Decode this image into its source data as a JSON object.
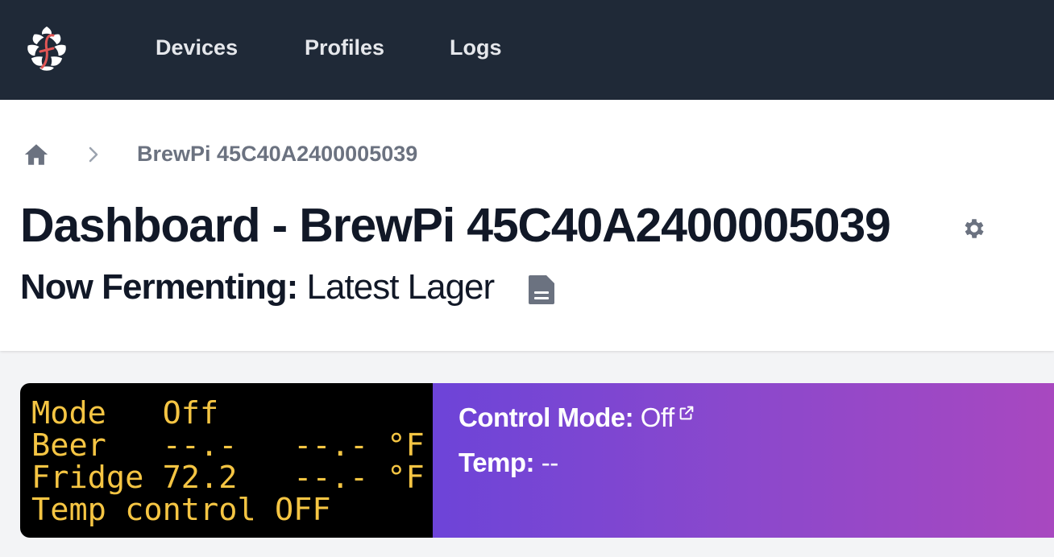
{
  "nav": {
    "logo_alt": "hop logo",
    "links": [
      {
        "label": "Devices"
      },
      {
        "label": "Profiles"
      },
      {
        "label": "Logs"
      }
    ]
  },
  "breadcrumb": {
    "home_icon": "home-icon",
    "separator_icon": "chevron-right-icon",
    "current": "BrewPi 45C40A2400005039"
  },
  "header": {
    "title": "Dashboard - BrewPi 45C40A2400005039",
    "settings_icon": "gear-icon",
    "fermenting_label": "Now Fermenting:",
    "fermenting_value": " Latest Lager",
    "profile_icon": "document-icon"
  },
  "lcd": {
    "lines": [
      "Mode   Off",
      "Beer   --.-   --.- °F",
      "Fridge 72.2   --.- °F",
      "Temp control OFF"
    ],
    "text_color": "#f5c543",
    "background": "#000000"
  },
  "control": {
    "mode_label": "Control Mode:",
    "mode_value": " Off",
    "temp_label": "Temp:",
    "temp_value": " --",
    "gradient_start": "#6d44d8",
    "gradient_end": "#a848c0"
  },
  "colors": {
    "nav_bg": "#1f2937",
    "page_bg": "#f3f4f6",
    "title_text": "#111827",
    "muted_text": "#6b7280"
  }
}
